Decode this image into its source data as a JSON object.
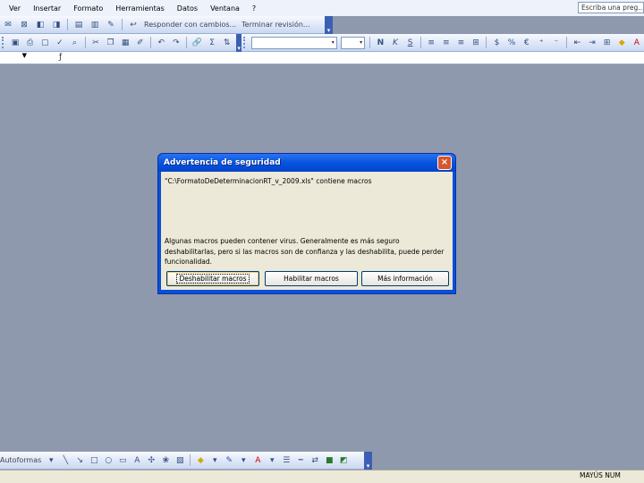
{
  "menubar": {
    "items": [
      "Ver",
      "Insertar",
      "Formato",
      "Herramientas",
      "Datos",
      "Ventana",
      "?"
    ],
    "help_placeholder": "Escriba una preg..."
  },
  "toolbar1": {
    "review_text": "Responder con cambios...",
    "end_review_text": "Terminar revisión..."
  },
  "dialog": {
    "title": "Advertencia de seguridad",
    "close_glyph": "×",
    "file_message": "\"C:\\FormatoDeDeterminacionRT_v_2009.xls\" contiene macros",
    "warning": "Algunas macros pueden contener virus. Generalmente es más seguro deshabilitarlas, pero si las macros son de confianza y las deshabilita, puede perder funcionalidad.",
    "buttons": {
      "disable": "Deshabilitar macros",
      "enable": "Habilitar macros",
      "more_info": "Más información"
    }
  },
  "drawbar": {
    "autoshapes_label": "Autoformas"
  },
  "statusbar": {
    "caps": "MAYÚS NUM"
  }
}
